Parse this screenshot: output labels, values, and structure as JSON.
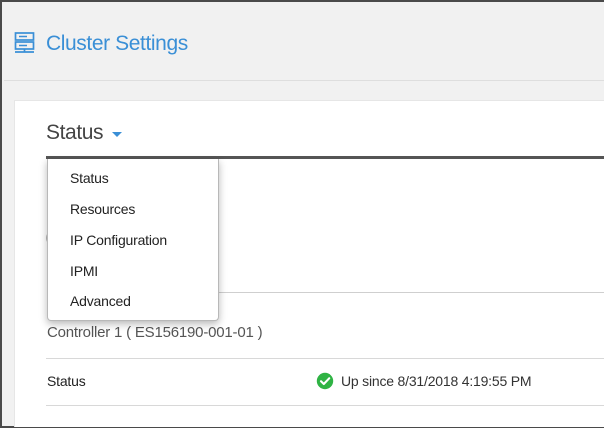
{
  "header": {
    "title": "Cluster Settings",
    "icon": "server-settings-icon",
    "title_color": "#3a8fd6"
  },
  "section": {
    "selected": "Status",
    "caret_icon": "caret-down-icon"
  },
  "dropdown": {
    "items": [
      {
        "label": "Status"
      },
      {
        "label": "Resources"
      },
      {
        "label": "IP Configuration"
      },
      {
        "label": "IPMI"
      },
      {
        "label": "Advanced"
      }
    ]
  },
  "controller": {
    "label": "Controller 1 ( ES156190-001-01 )"
  },
  "status_row": {
    "label": "Status",
    "value": "Up since 8/31/2018 4:19:55 PM",
    "icon": "check-circle-icon",
    "status_color": "#2fb344"
  }
}
